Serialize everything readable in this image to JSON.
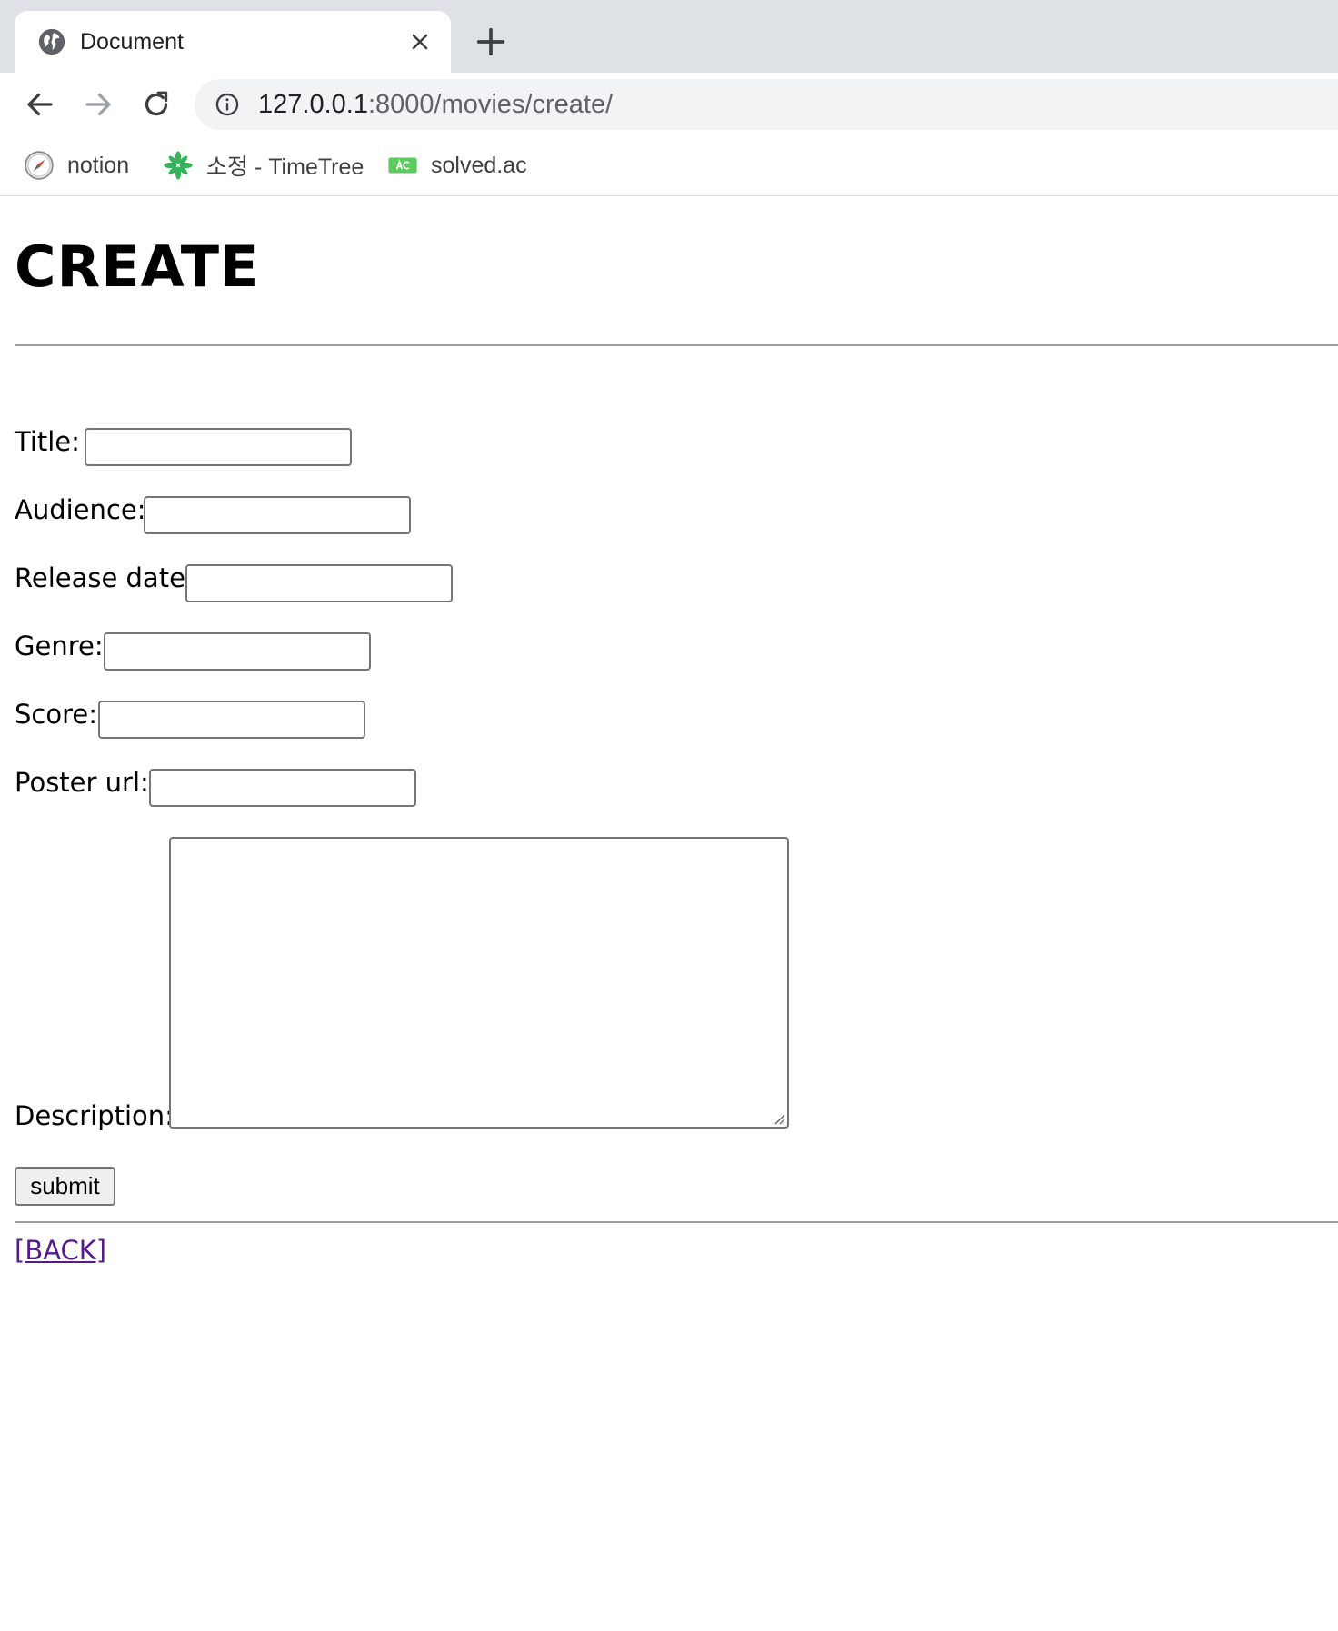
{
  "browser": {
    "tab": {
      "title": "Document",
      "favicon": "globe-icon",
      "close_icon": "close-icon"
    },
    "new_tab_icon": "plus-icon",
    "nav": {
      "back_icon": "arrow-left-icon",
      "forward_icon": "arrow-right-icon",
      "reload_icon": "reload-icon"
    },
    "address_bar": {
      "info_icon": "info-icon",
      "url_host": "127.0.0.1",
      "url_rest": ":8000/movies/create/"
    },
    "bookmarks": [
      {
        "label": "notion",
        "icon": "compass-icon"
      },
      {
        "label": "소정 - TimeTree",
        "icon": "timetree-icon"
      },
      {
        "label": "solved.ac",
        "icon": "solvedac-icon"
      }
    ]
  },
  "page": {
    "title": "CREATE",
    "form": {
      "fields": [
        {
          "label": "Title:",
          "value": ""
        },
        {
          "label": "Audience:",
          "value": ""
        },
        {
          "label": "Release date:",
          "value": ""
        },
        {
          "label": "Genre:",
          "value": ""
        },
        {
          "label": "Score:",
          "value": ""
        },
        {
          "label": "Poster url:",
          "value": ""
        }
      ],
      "description": {
        "label": "Description:",
        "value": ""
      },
      "submit_label": "submit"
    },
    "back_link": "[BACK]"
  },
  "colors": {
    "tabstrip": "#dee1e6",
    "omnibox": "#f1f3f4",
    "visited_link": "#551a8b",
    "timetree_green": "#34b35a",
    "solvedac_green": "#5ccb5f"
  }
}
